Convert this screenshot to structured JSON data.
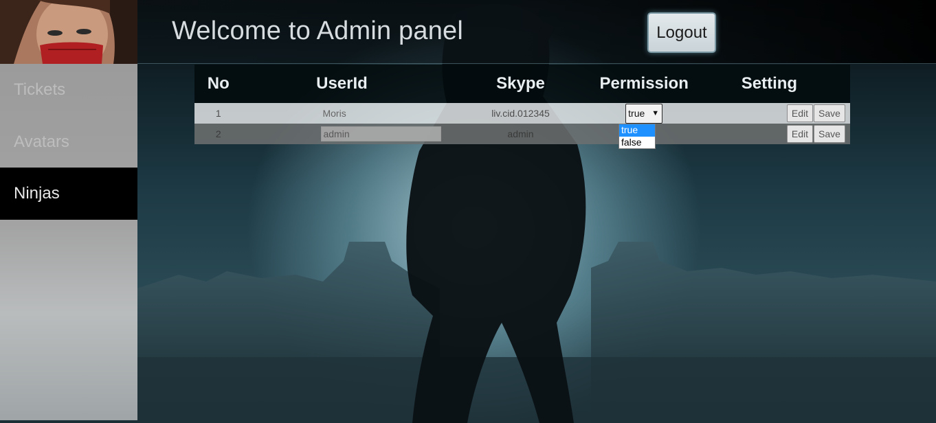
{
  "header": {
    "title": "Welcome to Admin panel",
    "logout_label": "Logout"
  },
  "sidebar": {
    "items": [
      {
        "label": "Tickets",
        "active": false
      },
      {
        "label": "Avatars",
        "active": false
      },
      {
        "label": "Ninjas",
        "active": true
      }
    ]
  },
  "table": {
    "columns": [
      "No",
      "UserId",
      "Skype",
      "Permission",
      "Setting"
    ],
    "rows": [
      {
        "no": "1",
        "user_id": "Moris",
        "skype": "liv.cid.012345",
        "permission": "true",
        "edit_label": "Edit",
        "save_label": "Save"
      },
      {
        "no": "2",
        "user_id": "admin",
        "skype": "admin",
        "permission": "",
        "edit_label": "Edit",
        "save_label": "Save"
      }
    ]
  },
  "permission_dropdown": {
    "options": [
      "true",
      "false"
    ],
    "highlighted": "true"
  },
  "colors": {
    "dropdown_highlight": "#1e90ff",
    "sidebar_active": "#000000"
  }
}
